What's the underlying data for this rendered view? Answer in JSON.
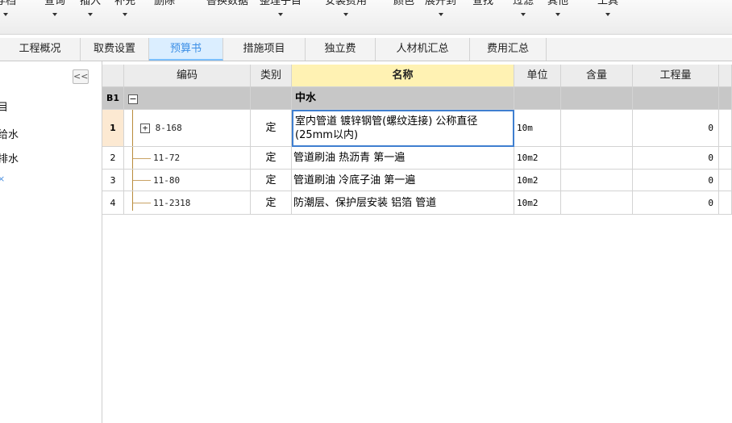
{
  "toolbar": {
    "items": [
      {
        "label": "存档",
        "has_arrow": true
      },
      {
        "label": "查询",
        "has_arrow": true
      },
      {
        "label": "插入",
        "has_arrow": true
      },
      {
        "label": "补充",
        "has_arrow": true
      },
      {
        "label": "删除",
        "has_arrow": false
      },
      {
        "label": "替换数据",
        "has_arrow": false
      },
      {
        "label": "整理子目",
        "has_arrow": true
      },
      {
        "label": "安装费用",
        "has_arrow": true
      },
      {
        "label": "颜色",
        "has_arrow": false
      },
      {
        "label": "展开到",
        "has_arrow": true
      },
      {
        "label": "查找",
        "has_arrow": false
      },
      {
        "label": "过滤",
        "has_arrow": true
      },
      {
        "label": "其他",
        "has_arrow": true
      },
      {
        "label": "工具",
        "has_arrow": true
      }
    ]
  },
  "tabs": [
    {
      "label": "工程概况"
    },
    {
      "label": "取费设置"
    },
    {
      "label": "预算书",
      "active": true
    },
    {
      "label": "措施项目"
    },
    {
      "label": "独立费"
    },
    {
      "label": "人材机汇总"
    },
    {
      "label": "费用汇总"
    }
  ],
  "sidebar": {
    "collapse_label": "<<",
    "items": [
      "目",
      "给水",
      "排水",
      "×"
    ]
  },
  "grid": {
    "headers": [
      "",
      "编码",
      "类别",
      "名称",
      "单位",
      "含量",
      "工程量"
    ],
    "group_row": {
      "label": "B1",
      "collapse": "−",
      "name": "中水"
    },
    "rows": [
      {
        "num": "1",
        "code": "8-168",
        "type": "定",
        "name_line1": "室内管道 镀锌钢管(螺纹连接) 公称直径",
        "name_line2": "(25mm以内)",
        "unit": "10m",
        "content": "",
        "quantity": "0"
      },
      {
        "num": "2",
        "code": "11-72",
        "type": "定",
        "name": "管道刷油 热沥青 第一遍",
        "unit": "10m2",
        "content": "",
        "quantity": "0"
      },
      {
        "num": "3",
        "code": "11-80",
        "type": "定",
        "name": "管道刷油 冷底子油 第一遍",
        "unit": "10m2",
        "content": "",
        "quantity": "0"
      },
      {
        "num": "4",
        "code": "11-2318",
        "type": "定",
        "name": "防潮层、保护层安装 铝箔 管道",
        "unit": "10m2",
        "content": "",
        "quantity": "0"
      }
    ]
  },
  "colors": {
    "active_tab": "#3c8fe6",
    "selected_header": "#fff2b3",
    "group_row": "#c7c7c7",
    "focus_border": "#3f7fd0"
  }
}
